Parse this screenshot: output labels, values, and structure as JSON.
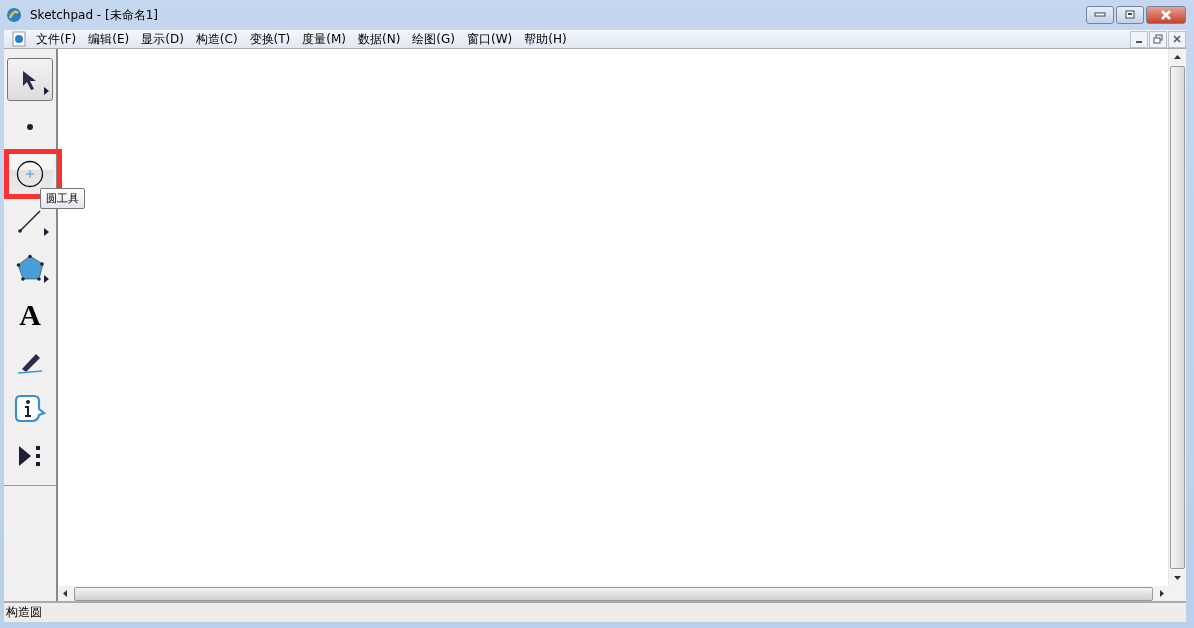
{
  "window": {
    "title": "Sketchpad  - [未命名1]"
  },
  "menu": [
    "文件(F)",
    "编辑(E)",
    "显示(D)",
    "构造(C)",
    "变换(T)",
    "度量(M)",
    "数据(N)",
    "绘图(G)",
    "窗口(W)",
    "帮助(H)"
  ],
  "tools": [
    {
      "kind": "arrow",
      "selected": true,
      "hovered": false,
      "submenu": true
    },
    {
      "kind": "point",
      "selected": false,
      "hovered": false,
      "submenu": false
    },
    {
      "kind": "circle",
      "selected": false,
      "hovered": true,
      "submenu": false
    },
    {
      "kind": "line",
      "selected": false,
      "hovered": false,
      "submenu": true
    },
    {
      "kind": "polygon",
      "selected": false,
      "hovered": false,
      "submenu": true
    },
    {
      "kind": "text",
      "selected": false,
      "hovered": false,
      "submenu": false,
      "glyph": "A"
    },
    {
      "kind": "marker",
      "selected": false,
      "hovered": false,
      "submenu": false
    },
    {
      "kind": "info",
      "selected": false,
      "hovered": false,
      "submenu": false
    },
    {
      "kind": "custom",
      "selected": false,
      "hovered": false,
      "submenu": false
    }
  ],
  "tooltip": "圆工具",
  "status_bar": "构造圆"
}
